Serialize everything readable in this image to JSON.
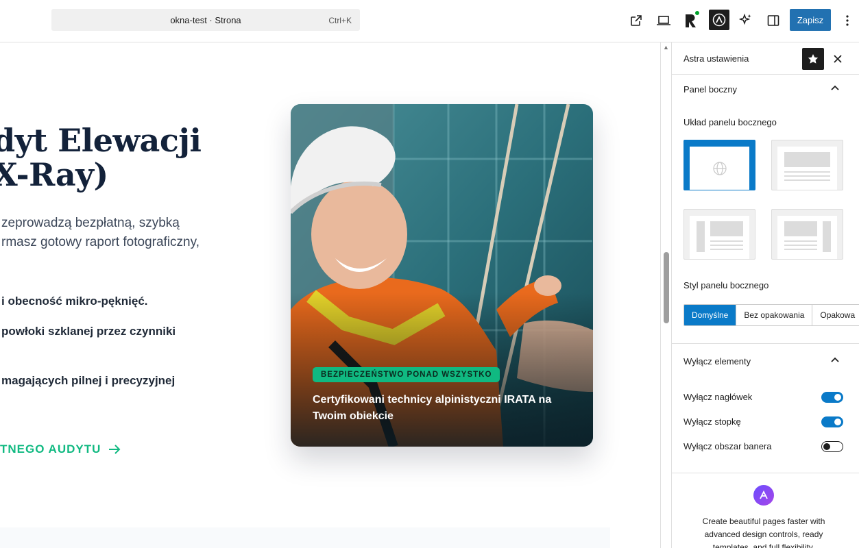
{
  "topbar": {
    "title": "okna-test · Strona",
    "shortcut": "Ctrl+K",
    "save_label": "Zapisz"
  },
  "canvas": {
    "hero_title_line1": "dyt Elewacji",
    "hero_title_line2": "X-Ray)",
    "hero_desc_line1": "zeprowadzą bezpłatną, szybką",
    "hero_desc_line2": "rmasz gotowy raport fotograficzny,",
    "bullet1": "i obecność mikro-pęknięć.",
    "bullet2": "powłoki szklanej przez czynniki",
    "bullet3": "magających pilnej i precyzyjnej",
    "cta": "TNEGO AUDYTU",
    "card_badge": "BEZPIECZEŃSTWO PONAD WSZYSTKO",
    "card_caption": "Certyfikowani technicy alpinistyczni IRATA na Twoim obiekcie"
  },
  "sidebar": {
    "title": "Astra ustawienia",
    "panel_section": "Panel boczny",
    "layout_label": "Układ panelu bocznego",
    "style_label": "Styl panelu bocznego",
    "style_options": [
      "Domyślne",
      "Bez opakowania",
      "Opakowa"
    ],
    "disable_section": "Wyłącz elementy",
    "toggles": [
      {
        "label": "Wyłącz nagłówek",
        "on": true
      },
      {
        "label": "Wyłącz stopkę",
        "on": true
      },
      {
        "label": "Wyłącz obszar banera",
        "on": false
      }
    ],
    "promo_text": "Create beautiful pages faster with advanced design controls, ready templates, and full flexibility."
  },
  "colors": {
    "accent": "#0a7ac8",
    "cta_green": "#10b981",
    "title_navy": "#13223a"
  }
}
